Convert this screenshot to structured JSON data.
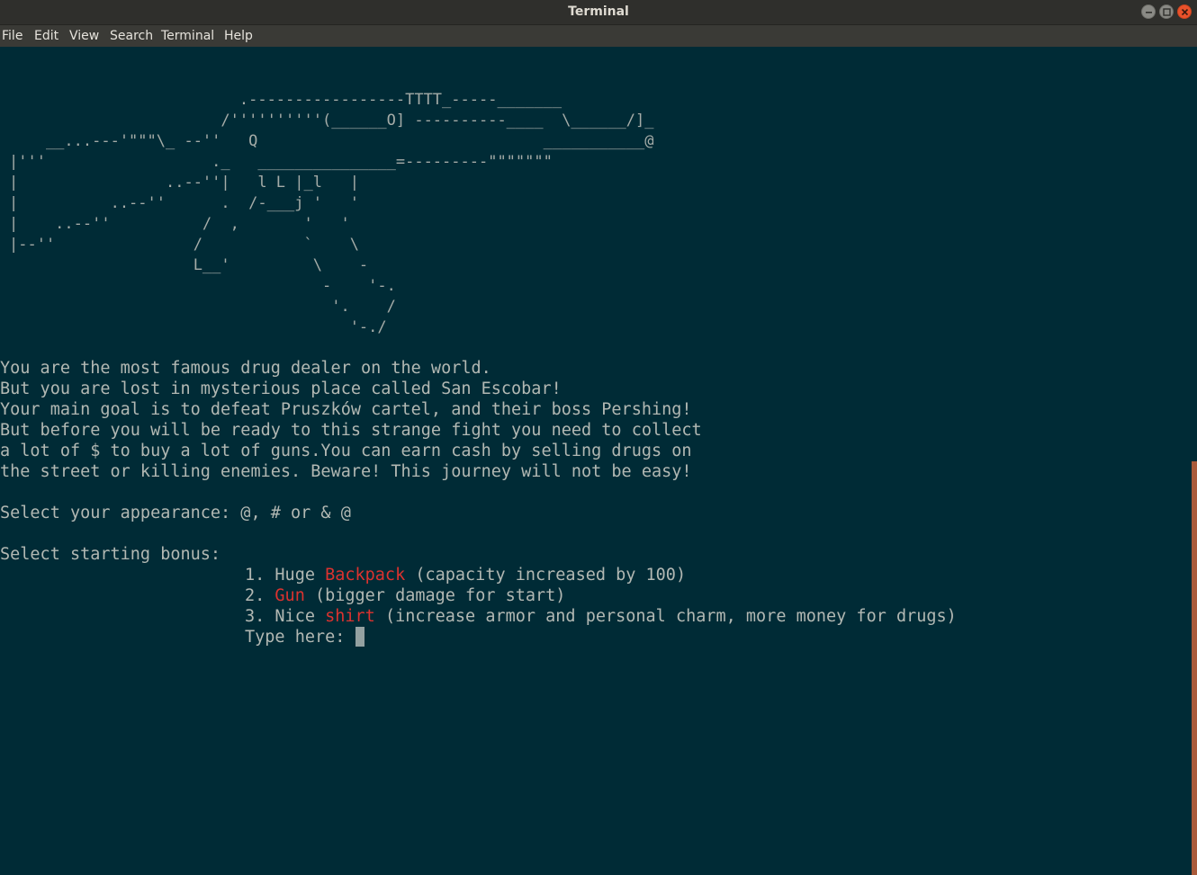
{
  "window": {
    "title": "Terminal"
  },
  "menu": [
    "File",
    "Edit",
    "View",
    "Search",
    "Terminal",
    "Help"
  ],
  "ascii_art": [
    "                         .-----------------TTTT_-----_______",
    "                       /''''''''''(______O] ----------____  \\______/]_",
    "    __...---'\"\"\"\\_ --''   Q                               ___________@",
    "|'''                  ._   _______________=---------\"\"\"\"\"\"\"",
    "|                ..--''|   l L |_l   |",
    "|          ..--''      .  /-___j '   '",
    "|    ..--''          /  ,       '   '",
    "|--''               /           `    \\",
    "                    L__'         \\    -",
    "                                  -    '-.",
    "                                   '.    /",
    "                                     '-./"
  ],
  "story": [
    "You are the most famous drug dealer on the world.",
    "But you are lost in mysterious place called San Escobar!",
    "Your main goal is to defeat Pruszków cartel, and their boss Pershing!",
    "But before you will be ready to this strange fight you need to collect",
    "a lot of $ to buy a lot of guns.You can earn cash by selling drugs on",
    "the street or killing enemies. Beware! This journey will not be easy!"
  ],
  "appearance_prompt": "Select your appearance: @, # or & @",
  "bonus_prompt": "Select starting bonus:",
  "options": [
    {
      "prefix": "1. Huge ",
      "highlight": "Backpack",
      "suffix": " (capacity increased by 100)"
    },
    {
      "prefix": "2. ",
      "highlight": "Gun",
      "suffix": " (bigger damage for start)"
    },
    {
      "prefix": "3. Nice ",
      "highlight": "shirt",
      "suffix": " (increase armor and personal charm, more money for drugs)"
    }
  ],
  "input_prompt": "Type here: ",
  "colors": {
    "background": "#002b36",
    "text": "#b2b8b3",
    "highlight": "#dc322f",
    "close_button": "#e9522b"
  }
}
